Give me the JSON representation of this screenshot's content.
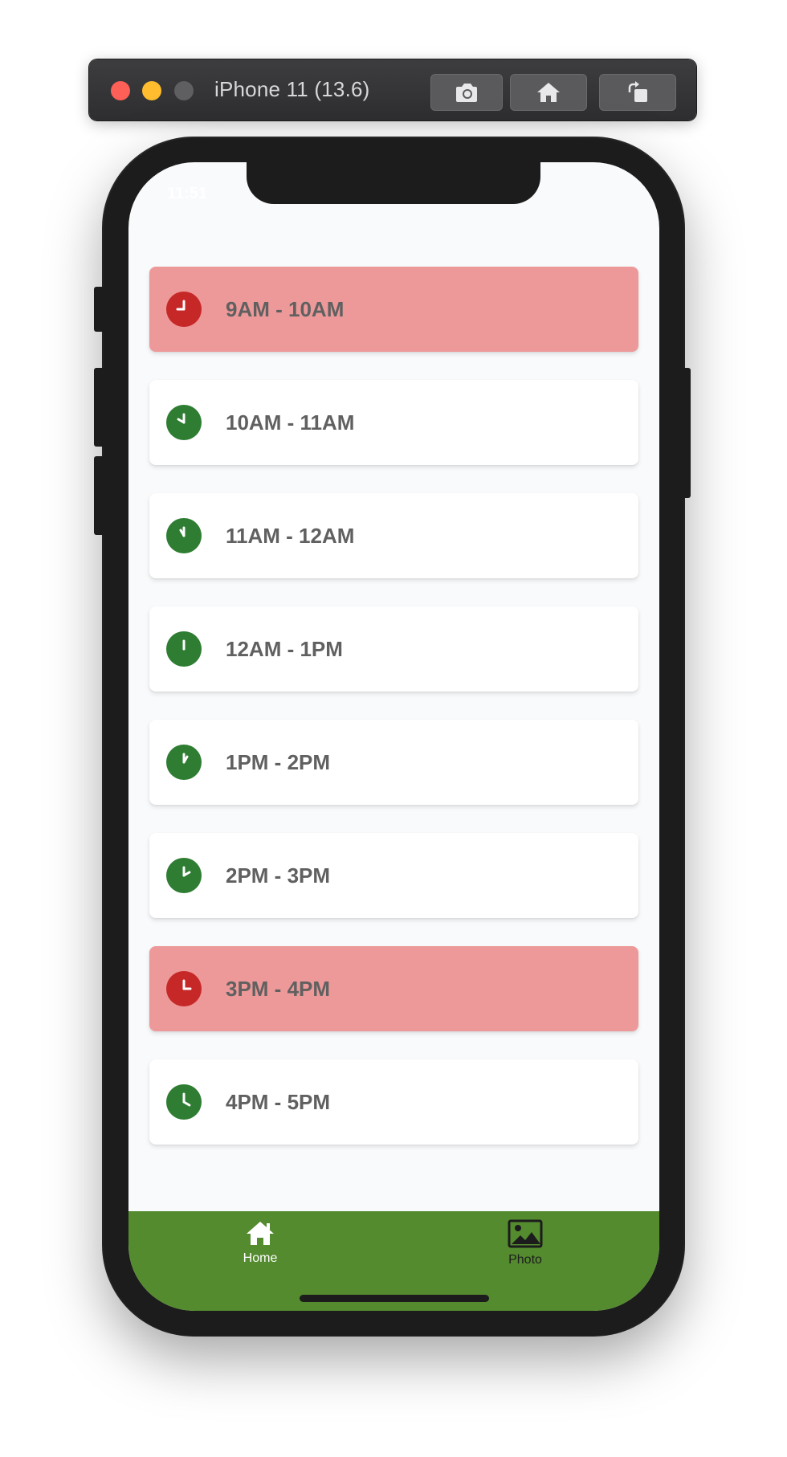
{
  "simulator": {
    "title": "iPhone 11 (13.6)",
    "buttons": [
      "screenshot-icon",
      "home-icon",
      "rotate-icon"
    ]
  },
  "status_bar": {
    "time": "11:51",
    "right": ""
  },
  "colors": {
    "booked_bg": "#ee9999",
    "booked_icon": "#c62828",
    "available_icon": "#2e7d32",
    "tab_bar": "#558b2f",
    "tab_active": "#ffffff",
    "tab_inactive": "#1c1c1c"
  },
  "slots": [
    {
      "label": "9AM - 10AM",
      "booked": true,
      "hour": 9
    },
    {
      "label": "10AM - 11AM",
      "booked": false,
      "hour": 10
    },
    {
      "label": "11AM - 12AM",
      "booked": false,
      "hour": 11
    },
    {
      "label": "12AM - 1PM",
      "booked": false,
      "hour": 12
    },
    {
      "label": "1PM - 2PM",
      "booked": false,
      "hour": 1
    },
    {
      "label": "2PM - 3PM",
      "booked": false,
      "hour": 2
    },
    {
      "label": "3PM - 4PM",
      "booked": true,
      "hour": 3
    },
    {
      "label": "4PM - 5PM",
      "booked": false,
      "hour": 4
    }
  ],
  "tabs": [
    {
      "label": "Home",
      "icon": "home-icon",
      "active": true
    },
    {
      "label": "Photo",
      "icon": "image-icon",
      "active": false
    }
  ]
}
